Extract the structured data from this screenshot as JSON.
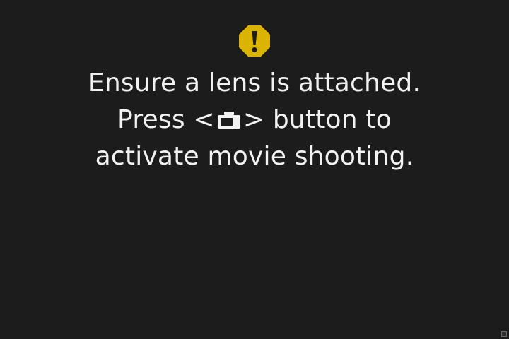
{
  "screen": {
    "background_color": "#1c1c1c",
    "text_color": "#f2f2f2",
    "warning_color": "#d9b400"
  },
  "icons": {
    "warning": "warning-octagon-icon",
    "button": "camera-button-icon"
  },
  "message": {
    "line1": "Ensure a lens is attached.",
    "line2_before": "Press <",
    "line2_after": "> button to",
    "line3": "activate movie shooting."
  }
}
